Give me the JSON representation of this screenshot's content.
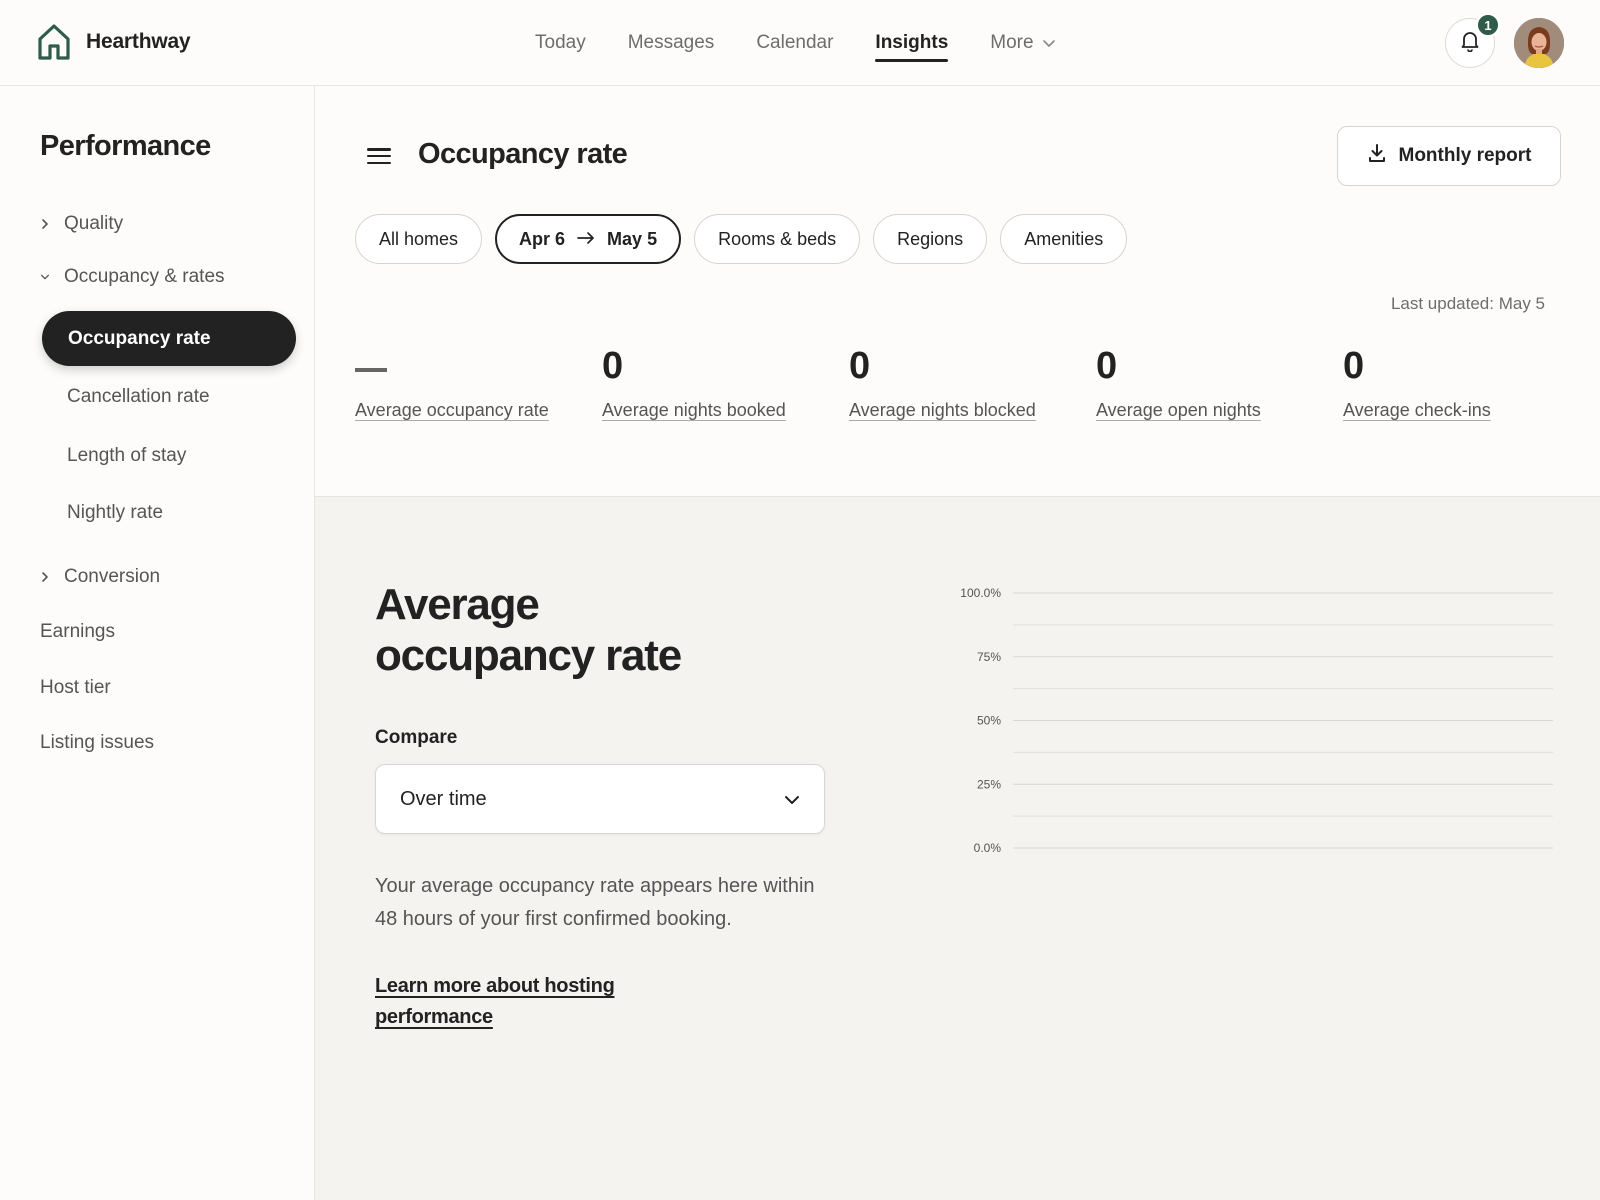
{
  "app": {
    "name": "Hearthway"
  },
  "nav": {
    "items": [
      {
        "label": "Today"
      },
      {
        "label": "Messages"
      },
      {
        "label": "Calendar"
      },
      {
        "label": "Insights"
      },
      {
        "label": "More"
      }
    ],
    "active": "Insights",
    "notifications_count": "1"
  },
  "sidebar": {
    "title": "Performance",
    "groups": {
      "quality": "Quality",
      "occupancy": "Occupancy & rates",
      "conversion": "Conversion"
    },
    "sub_items": {
      "occupancy_rate": "Occupancy rate",
      "cancellation_rate": "Cancellation rate",
      "length_of_stay": "Length of stay",
      "nightly_rate": "Nightly rate"
    },
    "items": {
      "earnings": "Earnings",
      "host_tier": "Host tier",
      "listing_issues": "Listing issues"
    }
  },
  "main": {
    "title": "Occupancy rate",
    "report_button": "Monthly report",
    "filters": {
      "homes": "All homes",
      "date_start": "Apr 6",
      "date_end": "May 5",
      "rooms": "Rooms & beds",
      "regions": "Regions",
      "amenities": "Amenities"
    },
    "last_updated": "Last updated: May 5",
    "metrics": [
      {
        "value": "",
        "label": "Average occupancy rate"
      },
      {
        "value": "0",
        "label": "Average nights booked"
      },
      {
        "value": "0",
        "label": "Average nights blocked"
      },
      {
        "value": "0",
        "label": "Average open nights"
      },
      {
        "value": "0",
        "label": "Average check-ins"
      }
    ]
  },
  "detail": {
    "title": "Average occupancy rate",
    "compare_label": "Compare",
    "compare_value": "Over time",
    "info": "Your average occupancy rate appears here within 48 hours of your first confirmed booking.",
    "learn_more": "Learn more about hosting performance"
  },
  "colors": {
    "brand": "#2f5b4b",
    "text": "#222222",
    "muted": "#6d6d6d"
  },
  "chart_data": {
    "type": "line",
    "y_ticks": [
      "100.0%",
      "75%",
      "50%",
      "25%",
      "0.0%"
    ],
    "ylim": [
      0,
      100
    ],
    "series": [],
    "grid": true
  }
}
